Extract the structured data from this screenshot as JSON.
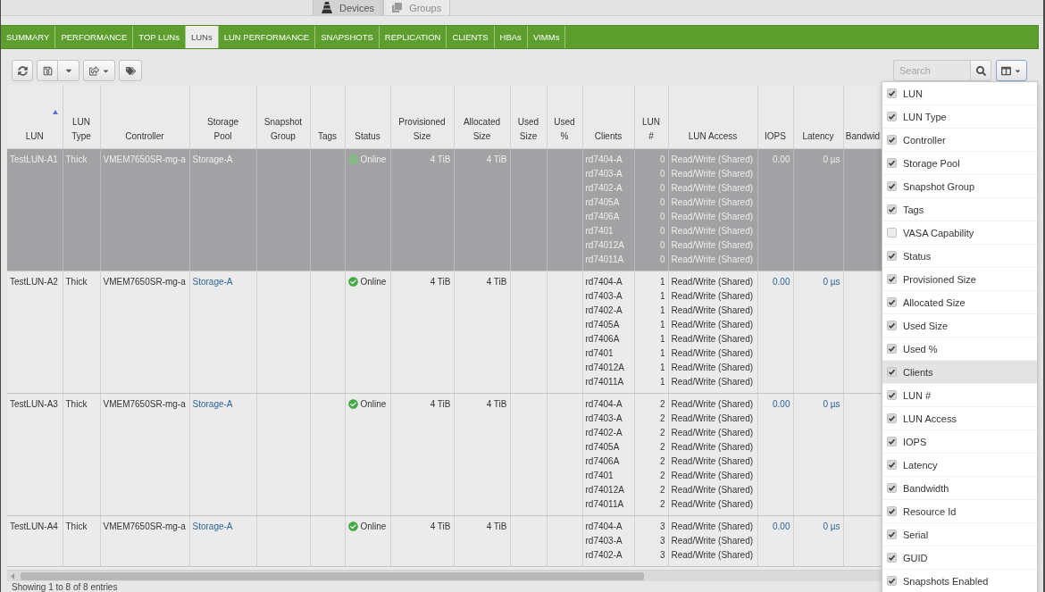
{
  "top_tabs": [
    {
      "label": "Devices",
      "selected": true
    },
    {
      "label": "Groups",
      "selected": false
    }
  ],
  "nav_tabs": [
    {
      "label": "SUMMARY",
      "selected": false
    },
    {
      "label": "PERFORMANCE",
      "selected": false
    },
    {
      "label": "TOP LUNs",
      "selected": false
    },
    {
      "label": "LUNs",
      "selected": true
    },
    {
      "label": "LUN PERFORMANCE",
      "selected": false
    },
    {
      "label": "SNAPSHOTS",
      "selected": false
    },
    {
      "label": "REPLICATION",
      "selected": false
    },
    {
      "label": "CLIENTS",
      "selected": false
    },
    {
      "label": "HBAs",
      "selected": false
    },
    {
      "label": "VIMMs",
      "selected": false
    }
  ],
  "toolbar": {
    "search": {
      "placeholder": "Search"
    },
    "column_menu_open": true
  },
  "table": {
    "columns": [
      {
        "label": "LUN",
        "sorted": true
      },
      {
        "label": "LUN\nType",
        "sorted": false
      },
      {
        "label": "Controller",
        "sorted": false
      },
      {
        "label": "Storage\nPool",
        "sorted": false
      },
      {
        "label": "Snapshot\nGroup",
        "sorted": false
      },
      {
        "label": "Tags",
        "sorted": false
      },
      {
        "label": "Status",
        "sorted": false
      },
      {
        "label": "Provisioned\nSize",
        "sorted": false
      },
      {
        "label": "Allocated\nSize",
        "sorted": false
      },
      {
        "label": "Used\nSize",
        "sorted": false
      },
      {
        "label": "Used\n%",
        "sorted": false
      },
      {
        "label": "Clients",
        "sorted": false
      },
      {
        "label": "LUN\n#",
        "sorted": false
      },
      {
        "label": "LUN Access",
        "sorted": false
      },
      {
        "label": "IOPS",
        "sorted": false
      },
      {
        "label": "Latency",
        "sorted": false
      },
      {
        "label": "Bandwid",
        "sorted": false
      }
    ],
    "rows": [
      {
        "selected": true,
        "lun": "TestLUN-A1",
        "lun_type": "Thick",
        "controller": "VMEM7650SR-mg-a",
        "storage_pool": "Storage-A",
        "status": {
          "label": "Online",
          "kind": "online"
        },
        "provisioned_size": "4 TiB",
        "allocated_size": "4 TiB",
        "clients": [
          {
            "name": "rd7404-A",
            "lun_number": "0",
            "access": "Read/Write (Shared)"
          },
          {
            "name": "rd7403-A",
            "lun_number": "0",
            "access": "Read/Write (Shared)"
          },
          {
            "name": "rd7402-A",
            "lun_number": "0",
            "access": "Read/Write (Shared)"
          },
          {
            "name": "rd7405A",
            "lun_number": "0",
            "access": "Read/Write (Shared)"
          },
          {
            "name": "rd7406A",
            "lun_number": "0",
            "access": "Read/Write (Shared)"
          },
          {
            "name": "rd7401",
            "lun_number": "0",
            "access": "Read/Write (Shared)"
          },
          {
            "name": "rd74012A",
            "lun_number": "0",
            "access": "Read/Write (Shared)"
          },
          {
            "name": "rd74011A",
            "lun_number": "0",
            "access": "Read/Write (Shared)"
          }
        ],
        "iops": "0.00",
        "latency": "0 µs"
      },
      {
        "selected": false,
        "lun": "TestLUN-A2",
        "lun_type": "Thick",
        "controller": "VMEM7650SR-mg-a",
        "storage_pool": "Storage-A",
        "status": {
          "label": "Online",
          "kind": "online"
        },
        "provisioned_size": "4 TiB",
        "allocated_size": "4 TiB",
        "clients": [
          {
            "name": "rd7404-A",
            "lun_number": "1",
            "access": "Read/Write (Shared)"
          },
          {
            "name": "rd7403-A",
            "lun_number": "1",
            "access": "Read/Write (Shared)"
          },
          {
            "name": "rd7402-A",
            "lun_number": "1",
            "access": "Read/Write (Shared)"
          },
          {
            "name": "rd7405A",
            "lun_number": "1",
            "access": "Read/Write (Shared)"
          },
          {
            "name": "rd7406A",
            "lun_number": "1",
            "access": "Read/Write (Shared)"
          },
          {
            "name": "rd7401",
            "lun_number": "1",
            "access": "Read/Write (Shared)"
          },
          {
            "name": "rd74012A",
            "lun_number": "1",
            "access": "Read/Write (Shared)"
          },
          {
            "name": "rd74011A",
            "lun_number": "1",
            "access": "Read/Write (Shared)"
          }
        ],
        "iops": "0.00",
        "latency": "0 µs"
      },
      {
        "selected": false,
        "lun": "TestLUN-A3",
        "lun_type": "Thick",
        "controller": "VMEM7650SR-mg-a",
        "storage_pool": "Storage-A",
        "status": {
          "label": "Online",
          "kind": "online"
        },
        "provisioned_size": "4 TiB",
        "allocated_size": "4 TiB",
        "clients": [
          {
            "name": "rd7404-A",
            "lun_number": "2",
            "access": "Read/Write (Shared)"
          },
          {
            "name": "rd7403-A",
            "lun_number": "2",
            "access": "Read/Write (Shared)"
          },
          {
            "name": "rd7402-A",
            "lun_number": "2",
            "access": "Read/Write (Shared)"
          },
          {
            "name": "rd7405A",
            "lun_number": "2",
            "access": "Read/Write (Shared)"
          },
          {
            "name": "rd7406A",
            "lun_number": "2",
            "access": "Read/Write (Shared)"
          },
          {
            "name": "rd7401",
            "lun_number": "2",
            "access": "Read/Write (Shared)"
          },
          {
            "name": "rd74012A",
            "lun_number": "2",
            "access": "Read/Write (Shared)"
          },
          {
            "name": "rd74011A",
            "lun_number": "2",
            "access": "Read/Write (Shared)"
          }
        ],
        "iops": "0.00",
        "latency": "0 µs"
      },
      {
        "selected": false,
        "lun": "TestLUN-A4",
        "lun_type": "Thick",
        "controller": "VMEM7650SR-mg-a",
        "storage_pool": "Storage-A",
        "status": {
          "label": "Online",
          "kind": "online"
        },
        "provisioned_size": "4 TiB",
        "allocated_size": "4 TiB",
        "clients": [
          {
            "name": "rd7404-A",
            "lun_number": "3",
            "access": "Read/Write (Shared)"
          },
          {
            "name": "rd7403-A",
            "lun_number": "3",
            "access": "Read/Write (Shared)"
          },
          {
            "name": "rd7402-A",
            "lun_number": "3",
            "access": "Read/Write (Shared)"
          }
        ],
        "iops": "0.00",
        "latency": "0 µs"
      }
    ]
  },
  "column_menu": {
    "items": [
      {
        "label": "LUN",
        "checked": true,
        "hovered": false
      },
      {
        "label": "LUN Type",
        "checked": true,
        "hovered": false
      },
      {
        "label": "Controller",
        "checked": true,
        "hovered": false
      },
      {
        "label": "Storage Pool",
        "checked": true,
        "hovered": false
      },
      {
        "label": "Snapshot Group",
        "checked": true,
        "hovered": false
      },
      {
        "label": "Tags",
        "checked": true,
        "hovered": false
      },
      {
        "label": "VASA Capability",
        "checked": false,
        "hovered": false
      },
      {
        "label": "Status",
        "checked": true,
        "hovered": false
      },
      {
        "label": "Provisioned Size",
        "checked": true,
        "hovered": false
      },
      {
        "label": "Allocated Size",
        "checked": true,
        "hovered": false
      },
      {
        "label": "Used Size",
        "checked": true,
        "hovered": false
      },
      {
        "label": "Used %",
        "checked": true,
        "hovered": false
      },
      {
        "label": "Clients",
        "checked": true,
        "hovered": true
      },
      {
        "label": "LUN #",
        "checked": true,
        "hovered": false
      },
      {
        "label": "LUN Access",
        "checked": true,
        "hovered": false
      },
      {
        "label": "IOPS",
        "checked": true,
        "hovered": false
      },
      {
        "label": "Latency",
        "checked": true,
        "hovered": false
      },
      {
        "label": "Bandwidth",
        "checked": true,
        "hovered": false
      },
      {
        "label": "Resource Id",
        "checked": true,
        "hovered": false
      },
      {
        "label": "Serial",
        "checked": true,
        "hovered": false
      },
      {
        "label": "GUID",
        "checked": true,
        "hovered": false
      },
      {
        "label": "Snapshots Enabled",
        "checked": true,
        "hovered": false
      }
    ]
  },
  "status_bar": "Showing 1 to 8 of 8 entries"
}
